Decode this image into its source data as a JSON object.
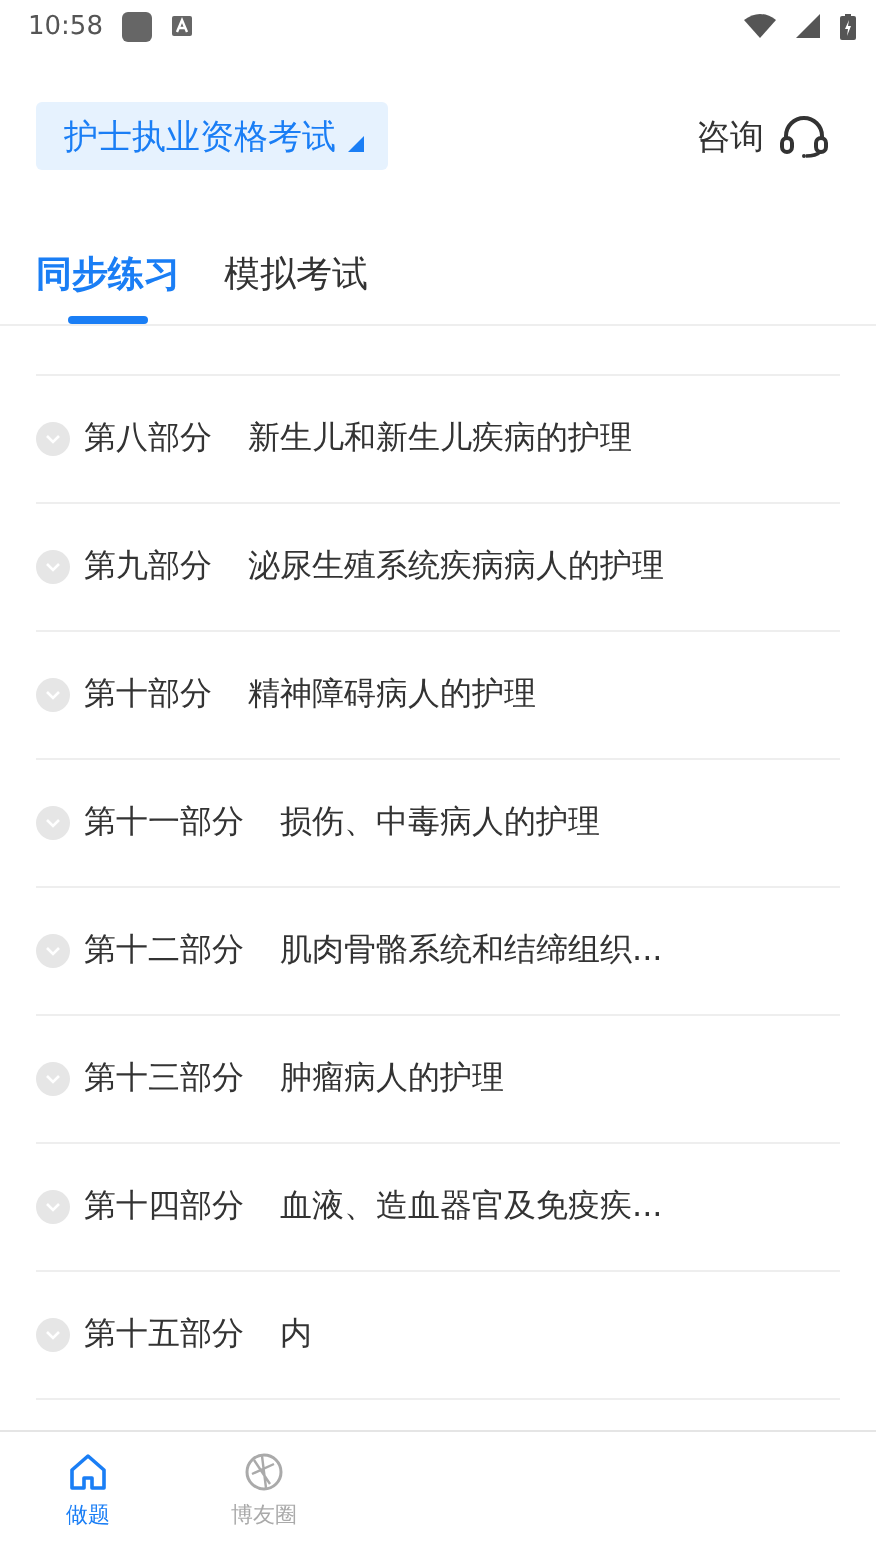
{
  "status_bar": {
    "time": "10:58"
  },
  "header": {
    "exam_selector": "护士执业资格考试",
    "consult": "咨询"
  },
  "tabs": [
    {
      "label": "同步练习",
      "selected": true
    },
    {
      "label": "模拟考试",
      "selected": false
    }
  ],
  "chapters": [
    {
      "part": "第八部分",
      "title": "新生儿和新生儿疾病的护理"
    },
    {
      "part": "第九部分",
      "title": "泌尿生殖系统疾病病人的护理"
    },
    {
      "part": "第十部分",
      "title": "精神障碍病人的护理"
    },
    {
      "part": "第十一部分",
      "title": "损伤、中毒病人的护理"
    },
    {
      "part": "第十二部分",
      "title": "肌肉骨骼系统和结缔组织..."
    },
    {
      "part": "第十三部分",
      "title": "肿瘤病人的护理"
    },
    {
      "part": "第十四部分",
      "title": "血液、造血器官及免疫疾..."
    },
    {
      "part": "第十五部分",
      "title": "内"
    }
  ],
  "bottom_nav": [
    {
      "label": "做题",
      "selected": true
    },
    {
      "label": "博友圈",
      "selected": false
    }
  ]
}
